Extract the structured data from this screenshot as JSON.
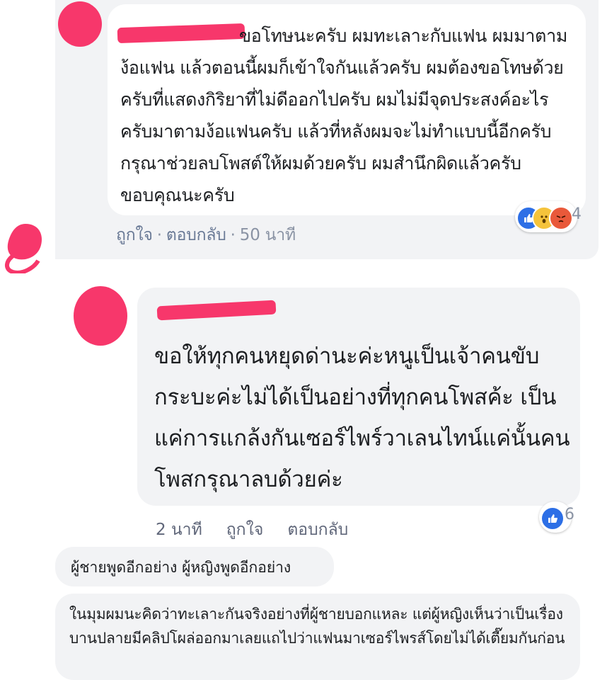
{
  "comment1": {
    "text": "ขอโทษนะครับ ผมทะเลาะกับแฟน ผมมาตามง้อแฟน แล้วตอนนี้ผมก็เข้าใจกันแล้วครับ ผมต้องขอโทษด้วยครับที่แสดงกิริยาที่ไม่ดีออกไปครับ ผมไม่มีจุดประสงค์อะไรครับมาตามง้อแฟนครับ แล้วที่หลังผมจะไม่ทำแบบนี้อีกครับ กรุณาช่วยลบโพสต์ให้ผมด้วยครับ ผมสำนึกผิดแล้วครับ ขอบคุณนะครับ",
    "actions": {
      "like": "ถูกใจ",
      "reply": "ตอบกลับ",
      "time": "50 นาที"
    },
    "reactions": {
      "icons": [
        "like-icon",
        "wow-icon",
        "angry-icon"
      ],
      "count": "4"
    }
  },
  "comment2": {
    "text": "ขอให้ทุกคนหยุดด่านะค่ะหนูเป็นเจ้าคนขับกระบะค่ะไม่ได้เป็นอย่างที่ทุกคนโพสค้ะ เป็นแค่การแกล้งกันเซอร์ไพร์วาเลนไทน์แค่นั้นคนโพสกรุณาลบด้วยค่ะ",
    "actions": {
      "time": "2 นาที",
      "like": "ถูกใจ",
      "reply": "ตอบกลับ"
    },
    "reactions": {
      "icons": [
        "like-icon"
      ],
      "count": "6"
    }
  },
  "reply1": {
    "text": "ผู้ชายพูดอีกอย่าง ผู้หญิงพูดอีกอย่าง"
  },
  "reply2": {
    "text": "ในมุมผมนะคิดว่าทะเลาะกันจริงอย่างที่ผู้ชายบอกแหละ แต่ผู้หญิงเห็นว่าเป็นเรื่องบานปลายมีคลิปโผล่ออกมาเลยแถไปว่าแฟนมาเซอร์ไพรส์โดยไม่ได้เตี๊ยมกันก่อน"
  },
  "colors": {
    "redaction": "#f7376b",
    "bubble": "#f2f3f5",
    "like": "#2d6fe6"
  }
}
